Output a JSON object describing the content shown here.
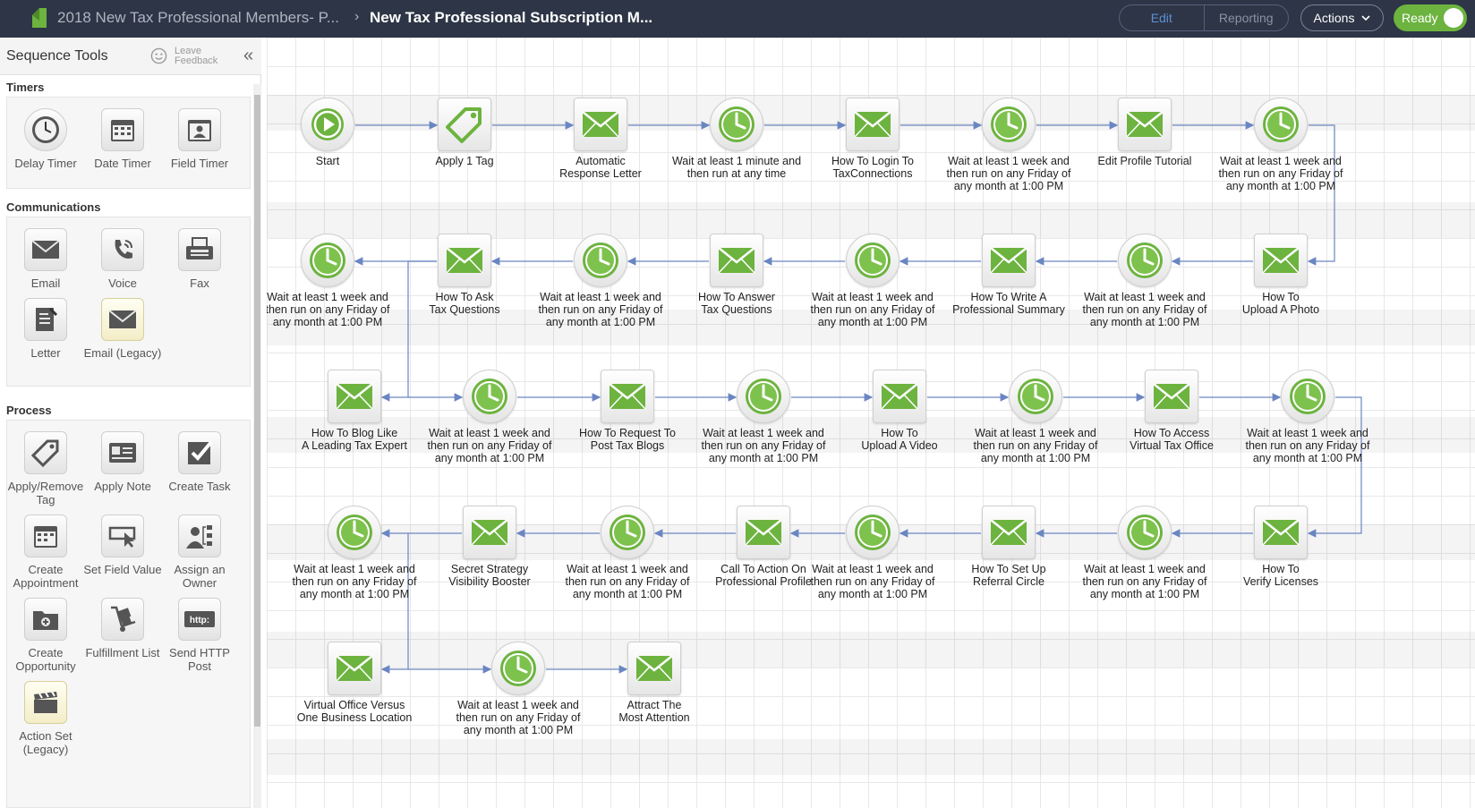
{
  "header": {
    "breadcrumb_parent": "2018 New Tax Professional Members- P...",
    "breadcrumb_separator": "›",
    "title": "New Tax Professional  Subscription M...",
    "mode_edit": "Edit",
    "mode_reporting": "Reporting",
    "actions_label": "Actions",
    "ready_label": "Ready",
    "ready_on": true
  },
  "sidebar": {
    "title": "Sequence Tools",
    "feedback_label": "Leave Feedback",
    "collapse_glyph": "«",
    "sections": {
      "timers": {
        "title": "Timers",
        "items": [
          "Delay Timer",
          "Date Timer",
          "Field Timer"
        ]
      },
      "communications": {
        "title": "Communications",
        "items": [
          "Email",
          "Voice",
          "Fax",
          "Letter",
          "Email (Legacy)"
        ]
      },
      "process": {
        "title": "Process",
        "items": [
          "Apply/Remove Tag",
          "Apply Note",
          "Create Task",
          "Create Appointment",
          "Set Field Value",
          "Assign an Owner",
          "Create Opportunity",
          "Fulfillment List",
          "Send HTTP Post",
          "Action Set (Legacy)"
        ]
      }
    }
  },
  "colors": {
    "topbar": "#2d3546",
    "accent_green": "#6db33f",
    "connector": "#6a86c2"
  },
  "sequence": {
    "row1": [
      {
        "type": "start",
        "label": "Start"
      },
      {
        "type": "tag",
        "label": "Apply 1 Tag"
      },
      {
        "type": "email",
        "label": "Automatic\nResponse Letter"
      },
      {
        "type": "timer",
        "label": "Wait at least 1 minute and\nthen run at any time"
      },
      {
        "type": "email",
        "label": "How To Login To\nTaxConnections"
      },
      {
        "type": "timer",
        "label": "Wait at least 1 week and\nthen run on any Friday of\nany month at 1:00 PM"
      },
      {
        "type": "email",
        "label": "Edit Profile Tutorial"
      },
      {
        "type": "timer",
        "label": "Wait at least 1 week and\nthen run on any Friday of\nany month at 1:00 PM"
      }
    ],
    "row2": [
      {
        "type": "timer",
        "label": "Wait at least 1 week and\nthen run on any Friday of\nany month at 1:00 PM"
      },
      {
        "type": "email",
        "label": "How To Ask\nTax Questions"
      },
      {
        "type": "timer",
        "label": "Wait at least 1 week and\nthen run on any Friday of\nany month at 1:00 PM"
      },
      {
        "type": "email",
        "label": "How To Answer\nTax Questions"
      },
      {
        "type": "timer",
        "label": "Wait at least 1 week and\nthen run on any Friday of\nany month at 1:00 PM"
      },
      {
        "type": "email",
        "label": "How To Write A\nProfessional Summary"
      },
      {
        "type": "timer",
        "label": "Wait at least 1 week and\nthen run on any Friday of\nany month at 1:00 PM"
      },
      {
        "type": "email",
        "label": "How To\nUpload A Photo"
      }
    ],
    "row3": [
      {
        "type": "email",
        "label": "How To Blog Like\nA Leading Tax Expert"
      },
      {
        "type": "timer",
        "label": "Wait at least 1 week and\nthen run on any Friday of\nany month at 1:00 PM"
      },
      {
        "type": "email",
        "label": "How To Request To\nPost Tax Blogs"
      },
      {
        "type": "timer",
        "label": "Wait at least 1 week and\nthen run on any Friday of\nany month at 1:00 PM"
      },
      {
        "type": "email",
        "label": "How To\nUpload A Video"
      },
      {
        "type": "timer",
        "label": "Wait at least 1 week and\nthen run on any Friday of\nany month at 1:00 PM"
      },
      {
        "type": "email",
        "label": "How To Access\nVirtual Tax Office"
      },
      {
        "type": "timer",
        "label": "Wait at least 1 week and\nthen run on any Friday of\nany month at 1:00 PM"
      }
    ],
    "row4": [
      {
        "type": "timer",
        "label": "Wait at least 1 week and\nthen run on any Friday of\nany month at 1:00 PM"
      },
      {
        "type": "email",
        "label": "Secret Strategy\nVisibility Booster"
      },
      {
        "type": "timer",
        "label": "Wait at least 1 week and\nthen run on any Friday of\nany month at 1:00 PM"
      },
      {
        "type": "email",
        "label": "Call To Action On\nProfessional Profile"
      },
      {
        "type": "timer",
        "label": "Wait at least 1 week and\nthen run on any Friday of\nany month at 1:00 PM"
      },
      {
        "type": "email",
        "label": "How To Set Up\nReferral Circle"
      },
      {
        "type": "timer",
        "label": "Wait at least 1 week and\nthen run on any Friday of\nany month at 1:00 PM"
      },
      {
        "type": "email",
        "label": "How To\nVerify Licenses"
      }
    ],
    "row5": [
      {
        "type": "email",
        "label": "Virtual Office Versus\nOne Business Location"
      },
      {
        "type": "timer",
        "label": "Wait at least 1 week and\nthen run on any Friday of\nany month at 1:00 PM"
      },
      {
        "type": "email",
        "label": "Attract The\nMost Attention"
      }
    ]
  }
}
